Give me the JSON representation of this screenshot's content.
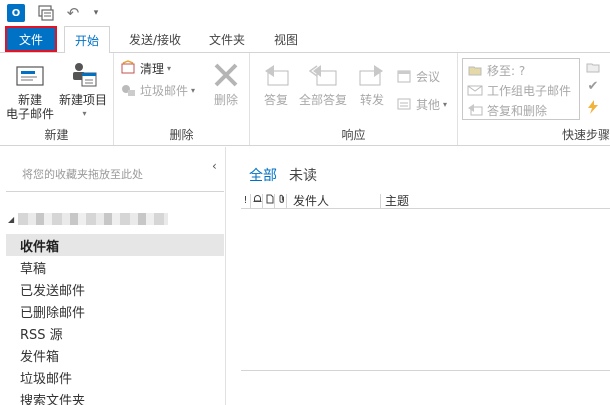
{
  "title_bar": {
    "app_badge": "O",
    "qat_caret": "▾"
  },
  "tabs": [
    {
      "label": "文件"
    },
    {
      "label": "开始"
    },
    {
      "label": "发送/接收"
    },
    {
      "label": "文件夹"
    },
    {
      "label": "视图"
    }
  ],
  "ribbon": {
    "new_group": {
      "label": "新建",
      "new_email": "新建\n电子邮件",
      "new_items": "新建项目"
    },
    "delete_group": {
      "label": "删除",
      "clean_up": "清理",
      "junk": "垃圾邮件",
      "delete": "删除"
    },
    "respond_group": {
      "label": "响应",
      "reply": "答复",
      "reply_all": "全部答复",
      "forward": "转发",
      "meeting": "会议",
      "more": "其他"
    },
    "quick_steps": {
      "label": "快速步骤",
      "move_to": "移至: ?",
      "team_email": "工作组电子邮件",
      "reply_delete": "答复和删除"
    }
  },
  "left_pane": {
    "fav_hint": "将您的收藏夹拖放至此处",
    "folders": [
      {
        "label": "收件箱",
        "selected": true
      },
      {
        "label": "草稿"
      },
      {
        "label": "已发送邮件"
      },
      {
        "label": "已删除邮件"
      },
      {
        "label": "RSS 源"
      },
      {
        "label": "发件箱"
      },
      {
        "label": "垃圾邮件"
      },
      {
        "label": "搜索文件夹"
      }
    ]
  },
  "message_list": {
    "filter_all": "全部",
    "filter_unread": "未读",
    "columns": {
      "importance": "!",
      "from": "发件人",
      "subject": "主题"
    }
  },
  "colors": {
    "accent": "#0072c6",
    "file_tab_border": "#e81123",
    "selected_folder_bg": "#e6e6e6"
  }
}
